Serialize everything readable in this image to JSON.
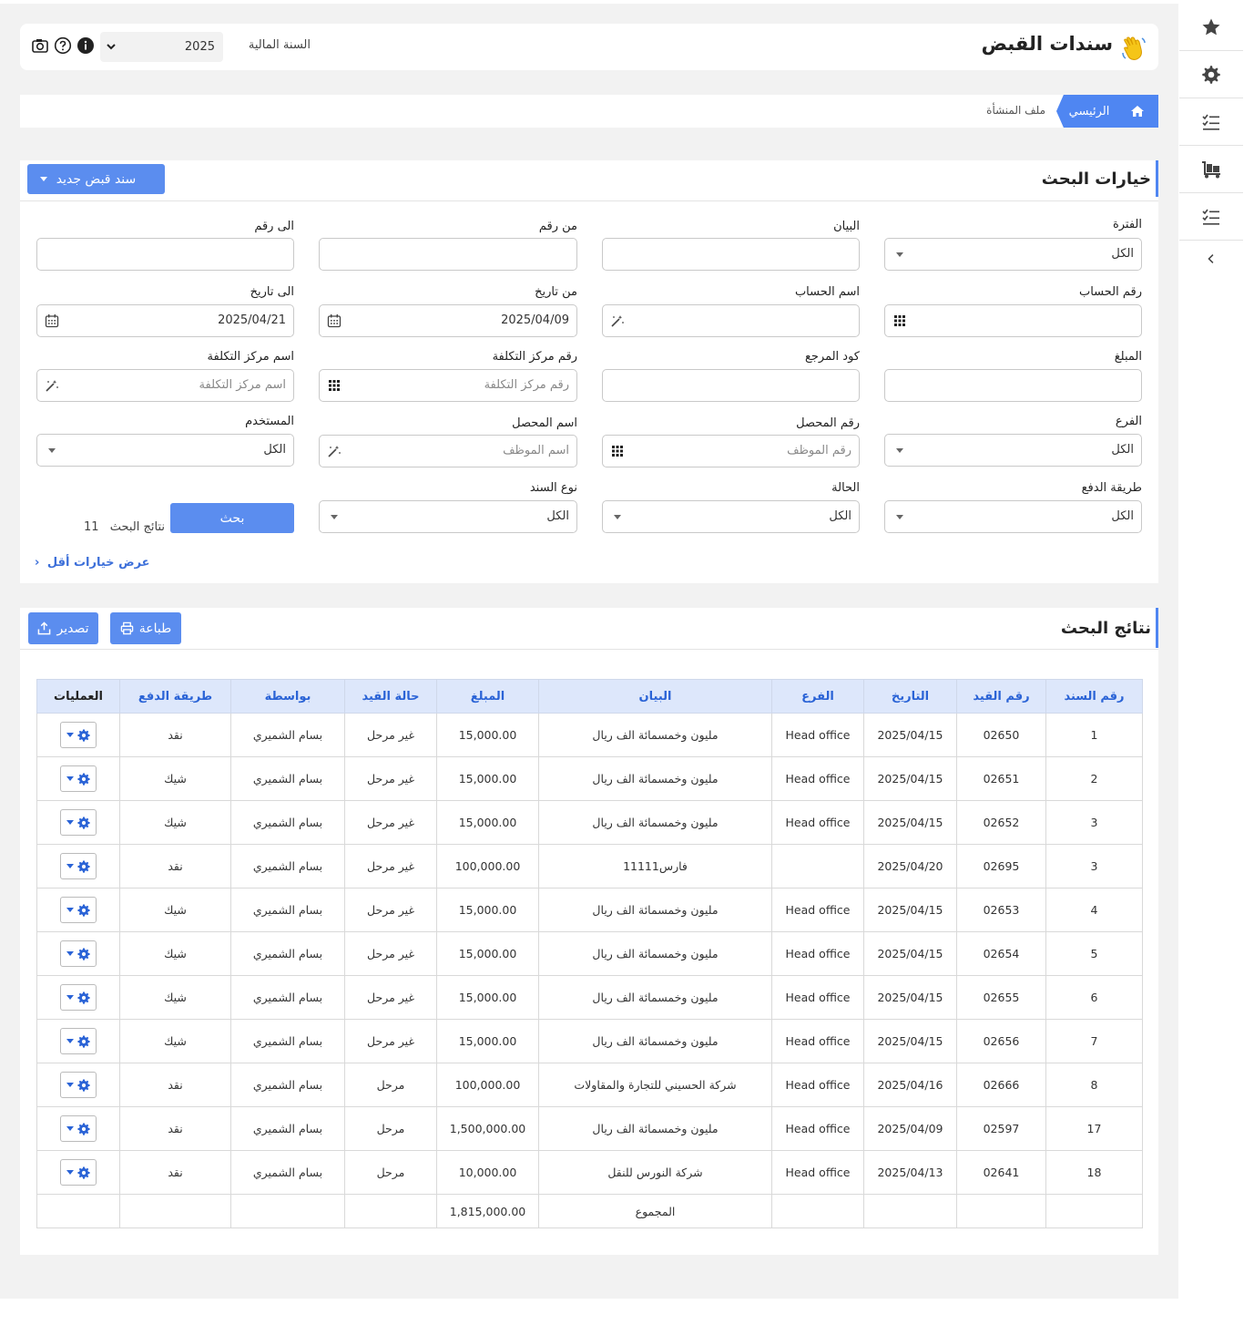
{
  "header": {
    "title": "سندات القبض",
    "fiscal_year_label": "السنة المالية",
    "fiscal_year_value": "2025",
    "icons": [
      "wave-hand-icon",
      "camera-icon",
      "help-icon",
      "info-icon",
      "chevron-down-icon"
    ]
  },
  "breadcrumb": {
    "home_icon": "home-icon",
    "main": "الرئيسي",
    "org": "ملف المنشأة"
  },
  "rail": {
    "icons": [
      "star-icon",
      "gear-icon",
      "checklist-icon",
      "dolly-icon",
      "checklist-icon",
      "chevron-left-icon"
    ]
  },
  "search": {
    "title": "خيارات البحث",
    "new_button": "سند قبض جديد",
    "fields": {
      "period": {
        "label": "الفترة",
        "value": "الكل"
      },
      "statement": {
        "label": "البيان",
        "value": ""
      },
      "from_number": {
        "label": "من رقم",
        "value": ""
      },
      "to_number": {
        "label": "الى رقم",
        "value": ""
      },
      "account_number": {
        "label": "رقم الحساب",
        "value": ""
      },
      "account_name": {
        "label": "اسم الحساب",
        "value": ""
      },
      "from_date": {
        "label": "من تاريخ",
        "value": "2025/04/09"
      },
      "to_date": {
        "label": "الى تاريخ",
        "value": "2025/04/21"
      },
      "amount": {
        "label": "المبلغ",
        "value": ""
      },
      "reference_code": {
        "label": "كود المرجع",
        "value": ""
      },
      "cost_center_number": {
        "label": "رقم مركز التكلفة",
        "placeholder": "رقم مركز التكلفة"
      },
      "cost_center_name": {
        "label": "اسم مركز التكلفة",
        "placeholder": "اسم مركز التكلفة"
      },
      "branch": {
        "label": "الفرع",
        "value": "الكل"
      },
      "collector_number": {
        "label": "رقم المحصل",
        "placeholder": "رقم الموظف"
      },
      "collector_name": {
        "label": "اسم المحصل",
        "placeholder": "اسم الموظف"
      },
      "user": {
        "label": "المستخدم",
        "value": "الكل"
      },
      "payment_method": {
        "label": "طريقة الدفع",
        "value": "الكل"
      },
      "status": {
        "label": "الحالة",
        "value": "الكل"
      },
      "voucher_type": {
        "label": "نوع السند",
        "value": "الكل"
      }
    },
    "search_button": "بحث",
    "results_label": "نتائج البحث",
    "results_count": "11",
    "less_options": "عرض خيارات أقل"
  },
  "results": {
    "title": "نتائج البحث",
    "print_button": "طباعة",
    "export_button": "تصدير",
    "columns": [
      "رقم السند",
      "رقم القيد",
      "التاريخ",
      "الفرع",
      "البيان",
      "المبلغ",
      "حالة القيد",
      "بواسطة",
      "طريقة الدفع",
      "العمليات"
    ],
    "rows": [
      [
        "1",
        "02650",
        "2025/04/15",
        "Head office",
        "مليون وخمسمائة الف ريال",
        "15,000.00",
        "غير مرحل",
        "بسام الشميري",
        "نقد"
      ],
      [
        "2",
        "02651",
        "2025/04/15",
        "Head office",
        "مليون وخمسمائة الف ريال",
        "15,000.00",
        "غير مرحل",
        "بسام الشميري",
        "شيك"
      ],
      [
        "3",
        "02652",
        "2025/04/15",
        "Head office",
        "مليون وخمسمائة الف ريال",
        "15,000.00",
        "غير مرحل",
        "بسام الشميري",
        "شيك"
      ],
      [
        "3",
        "02695",
        "2025/04/20",
        "",
        "فارس11111",
        "100,000.00",
        "غير مرحل",
        "بسام الشميري",
        "نقد"
      ],
      [
        "4",
        "02653",
        "2025/04/15",
        "Head office",
        "مليون وخمسمائة الف ريال",
        "15,000.00",
        "غير مرحل",
        "بسام الشميري",
        "شيك"
      ],
      [
        "5",
        "02654",
        "2025/04/15",
        "Head office",
        "مليون وخمسمائة الف ريال",
        "15,000.00",
        "غير مرحل",
        "بسام الشميري",
        "شيك"
      ],
      [
        "6",
        "02655",
        "2025/04/15",
        "Head office",
        "مليون وخمسمائة الف ريال",
        "15,000.00",
        "غير مرحل",
        "بسام الشميري",
        "شيك"
      ],
      [
        "7",
        "02656",
        "2025/04/15",
        "Head office",
        "مليون وخمسمائة الف ريال",
        "15,000.00",
        "غير مرحل",
        "بسام الشميري",
        "شيك"
      ],
      [
        "8",
        "02666",
        "2025/04/16",
        "Head office",
        "شركة الحسيني للتجارة والمقاولات",
        "100,000.00",
        "مرحل",
        "بسام الشميري",
        "نقد"
      ],
      [
        "17",
        "02597",
        "2025/04/09",
        "Head office",
        "مليون وخمسمائة الف ريال",
        "1,500,000.00",
        "مرحل",
        "بسام الشميري",
        "نقد"
      ],
      [
        "18",
        "02641",
        "2025/04/13",
        "Head office",
        "شركة النورس للنقل",
        "10,000.00",
        "مرحل",
        "بسام الشميري",
        "نقد"
      ]
    ],
    "total_label": "المجموع",
    "total_value": "1,815,000.00"
  },
  "colors": {
    "accent": "#4f86f2",
    "header_bg": "#dde7fb",
    "header_text": "#2a63d6"
  }
}
